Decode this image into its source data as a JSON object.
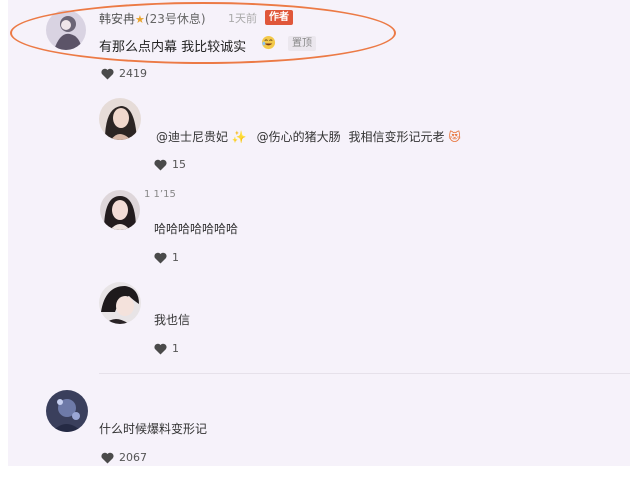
{
  "top_comment": {
    "username": "韩安冉",
    "tag": "(23号休息)",
    "time_ago": "1天前",
    "author_badge": "作者",
    "text": "有那么点内幕 我比较诚实",
    "pin_badge": "置顶",
    "likes": "2419"
  },
  "replies": [
    {
      "mention_1": "@迪士尼贵妃",
      "mention_2": "@伤心的猪大肠",
      "text": "我相信变形记元老",
      "likes": "15"
    },
    {
      "header_number": "1 1’15",
      "text": "哈哈哈哈哈哈哈",
      "likes": "1"
    },
    {
      "text": "我也信",
      "likes": "1"
    }
  ],
  "second_comment": {
    "text": "什么时候爆料变形记",
    "likes": "2067"
  },
  "colors": {
    "highlight": "#ec7a45",
    "author_badge": "#e0573a",
    "background": "#f6f2fa"
  }
}
